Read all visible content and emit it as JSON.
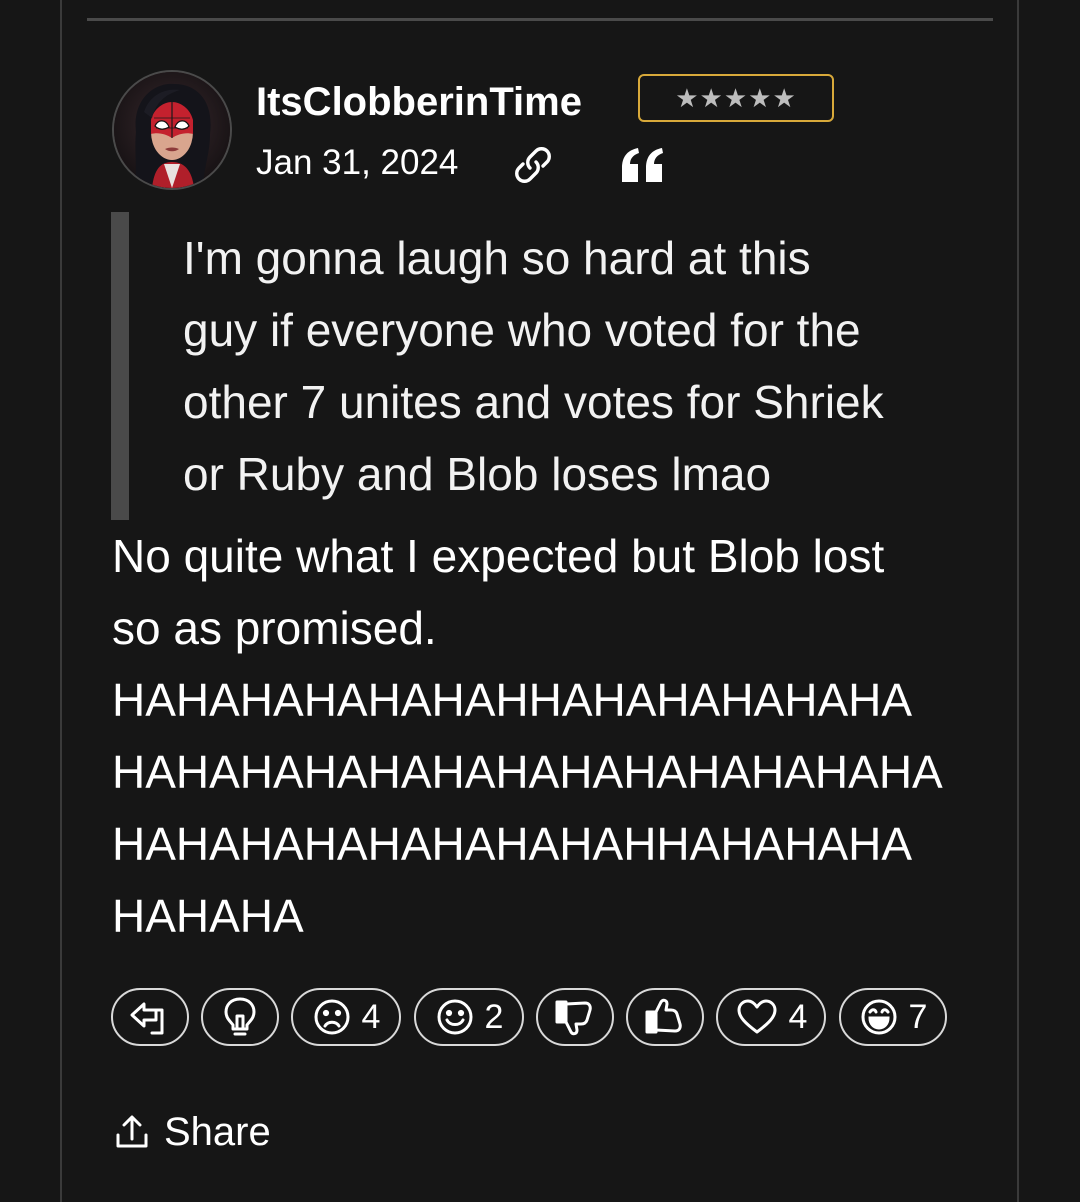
{
  "post": {
    "username": "ItsClobberinTime",
    "rank_stars": "★★★★★",
    "date": "Jan 31, 2024",
    "quote_lines": [
      "I'm gonna laugh so hard at this",
      "guy if everyone who voted for the",
      "other 7 unites and votes for Shriek",
      "or Ruby and Blob loses lmao"
    ],
    "body_lines": [
      "No quite what I expected but Blob lost",
      "so as promised.",
      "HAHAHAHAHAHAHHAHAHAHAHAHA",
      "HAHAHAHAHAHAHAHAHAHAHAHAHA",
      "HAHAHAHAHAHAHAHAHHAHAHAHA",
      "HAHAHA"
    ]
  },
  "reactions": [
    {
      "icon": "reply-arrow-icon",
      "count": ""
    },
    {
      "icon": "lightbulb-icon",
      "count": ""
    },
    {
      "icon": "sad-face-icon",
      "count": "4"
    },
    {
      "icon": "smile-face-icon",
      "count": "2"
    },
    {
      "icon": "thumbs-down-icon",
      "count": ""
    },
    {
      "icon": "thumbs-up-icon",
      "count": ""
    },
    {
      "icon": "heart-icon",
      "count": "4"
    },
    {
      "icon": "laugh-face-icon",
      "count": "7"
    }
  ],
  "share": {
    "label": "Share",
    "icon": "share-upload-icon"
  },
  "colors": {
    "background": "#161616",
    "rank_border": "#d8a93a",
    "quote_bar": "#4a4a4a",
    "text": "#ffffff"
  }
}
